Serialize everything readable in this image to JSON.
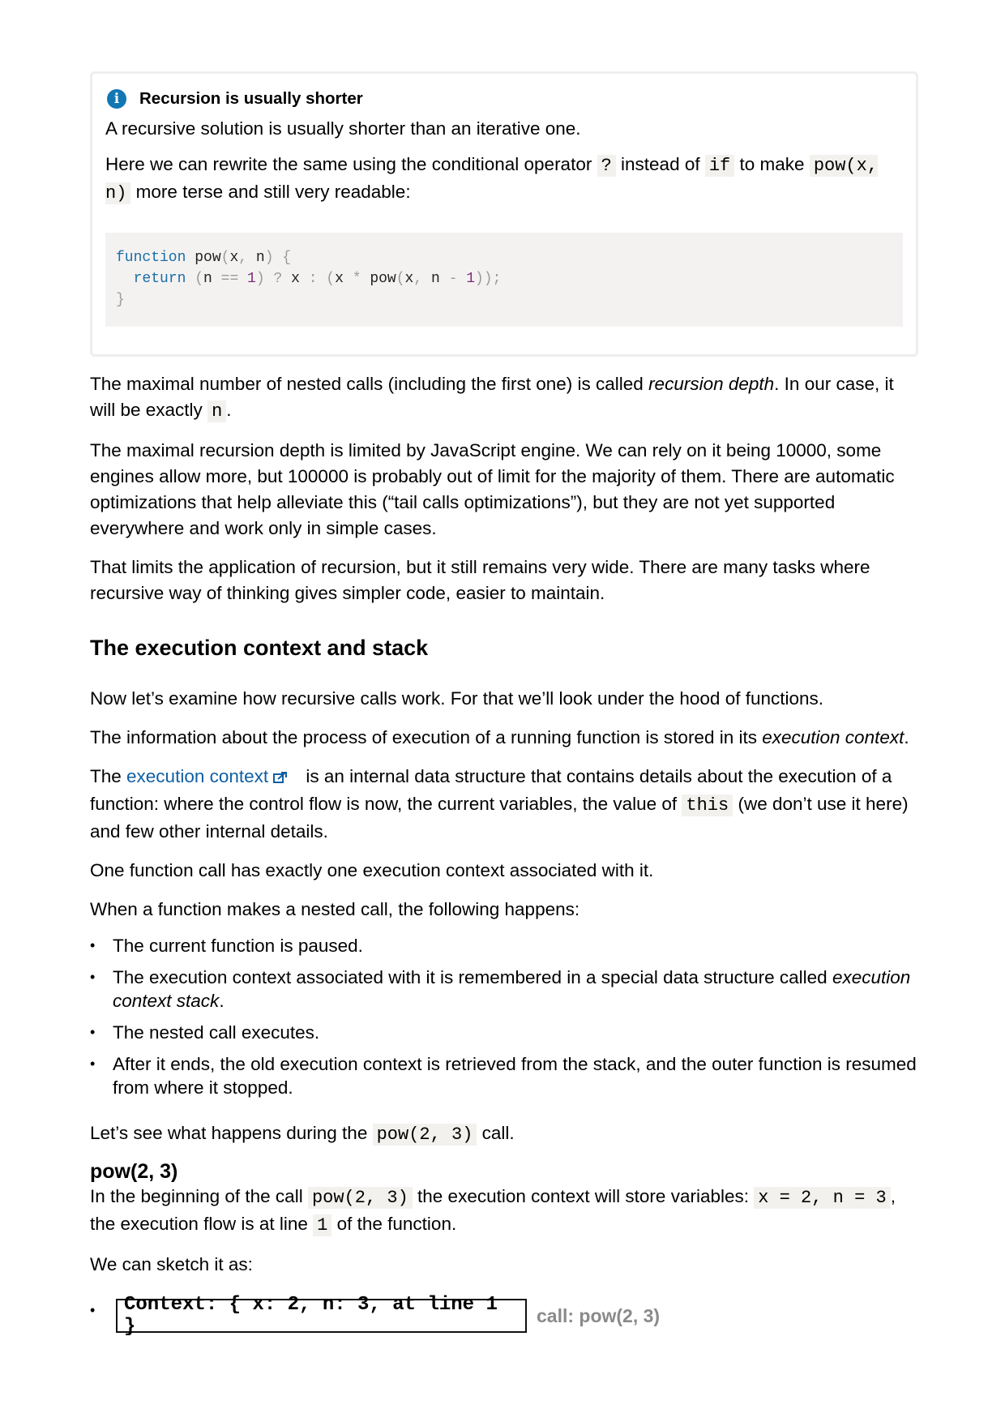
{
  "note": {
    "icon": "info-icon",
    "title": "Recursion is usually shorter",
    "p1": "A recursive solution is usually shorter than an iterative one.",
    "p2_a": "Here we can rewrite the same using the conditional operator ",
    "p2_code1": "?",
    "p2_b": " instead of ",
    "p2_code2": "if",
    "p2_c": " to make ",
    "p2_code3": "pow(x, n)",
    "p2_d": " more terse and still very readable:",
    "code": {
      "l1_kw": "function",
      "l1_rest": " pow",
      "l1_p1": "(",
      "l1_x": "x",
      "l1_c": ", ",
      "l1_n": "n",
      "l1_p2": ") {",
      "l2_indent": "  ",
      "l2_kw": "return",
      "l2_a": " (",
      "l2_n": "n ",
      "l2_eq": "==",
      "l2_1": " 1",
      "l2_b": ") ? ",
      "l2_x": "x ",
      "l2_colon": ": (",
      "l2_x2": "x ",
      "l2_star": "*",
      "l2_call": " pow",
      "l2_c": "(",
      "l2_x3": "x",
      "l2_comma": ", ",
      "l2_n2": "n ",
      "l2_minus": "-",
      "l2_one": " 1",
      "l2_end": "));",
      "l3": "}"
    }
  },
  "p_depth_a": "The maximal number of nested calls (including the first one) is called ",
  "p_depth_em": "recursion depth",
  "p_depth_b": ". In our case, it will be exactly ",
  "p_depth_code": "n",
  "p_depth_c": ".",
  "p_limit": "The maximal recursion depth is limited by JavaScript engine. We can rely on it being 10000, some engines allow more, but 100000 is probably out of limit for the majority of them. There are automatic optimizations that help alleviate this (“tail calls optimizations”), but they are not yet supported everywhere and work only in simple cases.",
  "p_application": "That limits the application of recursion, but it still remains very wide. There are many tasks where recursive way of thinking gives simpler code, easier to maintain.",
  "h_exec": "The execution context and stack",
  "p_examine": "Now let’s examine how recursive calls work. For that we’ll look under the hood of functions.",
  "p_info_a": "The information about the process of execution of a running function is stored in its ",
  "p_info_em": "execution context",
  "p_info_b": ".",
  "p_ctx_a": "The ",
  "p_ctx_link": "execution context",
  "p_ctx_b": " is an internal data structure that contains details about the execution of a function: where the control flow is now, the current variables, the value of ",
  "p_ctx_code": "this",
  "p_ctx_c": " (we don’t use it here) and few other internal details.",
  "p_one": "One function call has exactly one execution context associated with it.",
  "p_nested": "When a function makes a nested call, the following happens:",
  "bullets": {
    "b1": "The current function is paused.",
    "b2_a": "The execution context associated with it is remembered in a special data structure called ",
    "b2_em": "execution context stack",
    "b2_b": ".",
    "b3": "The nested call executes.",
    "b4": "After it ends, the old execution context is retrieved from the stack, and the outer function is resumed from where it stopped."
  },
  "p_see_a": "Let’s see what happens during the ",
  "p_see_code": "pow(2, 3)",
  "p_see_b": " call.",
  "h_pow": "pow(2, 3)",
  "p_begin_a": "In the beginning of the call ",
  "p_begin_code1": "pow(2, 3)",
  "p_begin_b": " the execution context will store variables: ",
  "p_begin_code2": "x = 2, n = 3",
  "p_begin_c": ", the execution flow is at line ",
  "p_begin_code3": "1",
  "p_begin_d": " of the function.",
  "p_sketch": "We can sketch it as:",
  "context_box": "Context: { x: 2, n: 3, at line 1 }",
  "context_call": "call: pow(2, 3)"
}
